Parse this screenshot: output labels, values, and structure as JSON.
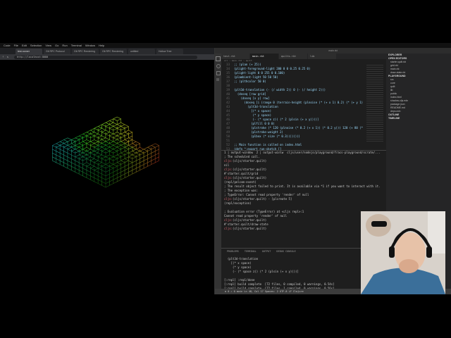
{
  "menubar": {
    "items": [
      "Code",
      "File",
      "Edit",
      "Selection",
      "View",
      "Go",
      "Run",
      "Terminal",
      "Window",
      "Help"
    ]
  },
  "browser": {
    "tabs": [
      "test-runner",
      "Git RPC Protocol",
      "Git RPC Rendering",
      "Git RPC Rendering",
      "untitled",
      "Hollow Tree"
    ],
    "url": "http://localhost:8080"
  },
  "vscode": {
    "title": "main.rkt",
    "tabs": [
      "test.rkt",
      "main.rkt",
      "quilts.rkt",
      "lib"
    ],
    "breadcrumb": "src › main.rkt › quilt",
    "code": [
      {
        "n": "33",
        "t": ";; (plan (+ 25))"
      },
      {
        "n": "34",
        "t": "(plight-foreground-light 200 0 0 0.25 0.25 0)"
      },
      {
        "n": "35",
        "t": "(plight-light 0 0 255 0 0.100)"
      },
      {
        "n": "36",
        "t": "(plambient-light 50 50 50)"
      },
      {
        "n": "37",
        "t": ";; (plthcolor 50 0)"
      },
      {
        "n": "38",
        "t": ""
      },
      {
        "n": "39",
        "t": "(plt3d-translation (- (/ width 2)) 0 (- (/ height 2)))"
      },
      {
        "n": "40",
        "t": "  (doseq [row grid]"
      },
      {
        "n": "41",
        "t": "    (doseq [x y] row]"
      },
      {
        "n": "42",
        "t": "      (doseq [i (range 0 (terrain-height (plnoise (* (+ x 1) 0.2) (* (+ y 1) 0.2))))]"
      },
      {
        "n": "43",
        "t": "        (plt3d-translation"
      },
      {
        "n": "44",
        "t": "          [(* x space)"
      },
      {
        "n": "45",
        "t": "           (* y space)"
      },
      {
        "n": "46",
        "t": "           (- (* space z)) (* 2 (plsin (+ x y))))]"
      },
      {
        "n": "47",
        "t": "          (plfill 0 0 0)"
      },
      {
        "n": "48",
        "t": "          (plstroke (* 120 (plnoise (* 0.2 (+ x 1)) (* 0.2 y))) 120 (+ 80 (* y 2)))"
      },
      {
        "n": "49",
        "t": "          (plstroke-weight 2)"
      },
      {
        "n": "50",
        "t": "          (plbox (* size (* 0.3))))))))"
      },
      {
        "n": "51",
        "t": ""
      },
      {
        "n": "52",
        "t": ";; Main function is called on index.html"
      },
      {
        "n": "53",
        "t": "(defn ^:export run-sketch []"
      }
    ],
    "panel_tabs": [
      "PROBLEMS",
      "TERMINAL",
      "OUTPUT",
      "DEBUG CONSOLE"
    ],
    "terminal": [
      {
        "p": "",
        "t": "1 | output-window  2 | output-winlw  cljs/user/nodejs/playground/fracs-playground/scrate/..."
      },
      {
        "p": "",
        "t": "; The scheduled call."
      },
      {
        "p": "cljs",
        "t": "(cljs/starter.quilt)"
      },
      {
        "p": "",
        "t": "nil"
      },
      {
        "p": "cljs",
        "t": "(cljs/starter.quilt)"
      },
      {
        "p": "",
        "t": "#'starter.quilt/grid"
      },
      {
        "p": "cljs",
        "t": "(cljs/starter.quilt)"
      },
      {
        "p": "",
        "t": "(repl/pelcom-event)"
      },
      {
        "p": "",
        "t": "; The result object failed to print. It is available via *1 if you want to interact with it."
      },
      {
        "p": "",
        "t": "; The exception was:"
      },
      {
        "p": "",
        "t": "; TypeError: Cannot read property 'render' of null"
      },
      {
        "p": "cljs",
        "t": "(cljs/starter.quilt) - [plcreate 5]"
      },
      {
        "p": "",
        "t": "(repl/exception)"
      },
      {
        "p": "",
        "t": ""
      },
      {
        "p": "",
        "t": "; Evaluation error (TypeError) at <cljs repl>:1"
      },
      {
        "p": "",
        "t": "Cannot read property 'render' of null"
      },
      {
        "p": "cljs",
        "t": "(cljs/starter.quilt)"
      },
      {
        "p": "",
        "t": "#'starter.quilt/draw-state"
      },
      {
        "p": "cljs",
        "t": "(cljs/starter.quilt)"
      }
    ],
    "output_lines": [
      "  (plt3d-translation",
      "    [(* x space)",
      "     (* y space)",
      "     (- (* space z)) (* 2 (plsin (+ x y))))]",
      "",
      "[:repl] :repl/done",
      "[:repl] build complete  [72 files, 0 compiled, 0 warnings, 0.54s]",
      "[:repl] build complete  [72 files, 1 compiled, 0 warnings, 0.56s]"
    ],
    "sidebar_title": "EXPLORER",
    "sidebar": [
      "OPEN EDITORS",
      "starter.quilt.rkt",
      "grid.rkt",
      "main.rkt",
      "draw-state.rkt",
      "PLAYGROUND",
      "src",
      "core",
      "quilt",
      "lib",
      "public",
      "index.html",
      "shadow-cljs.edn",
      "package.json",
      "README.md",
      "deps.edn",
      "OUTLINE",
      "TIMELINE"
    ],
    "status": "⊗ 0 ⚠ 0   main   Ln 48, Col 17   Spaces: 2   UTF-8   LF   Clojure"
  }
}
